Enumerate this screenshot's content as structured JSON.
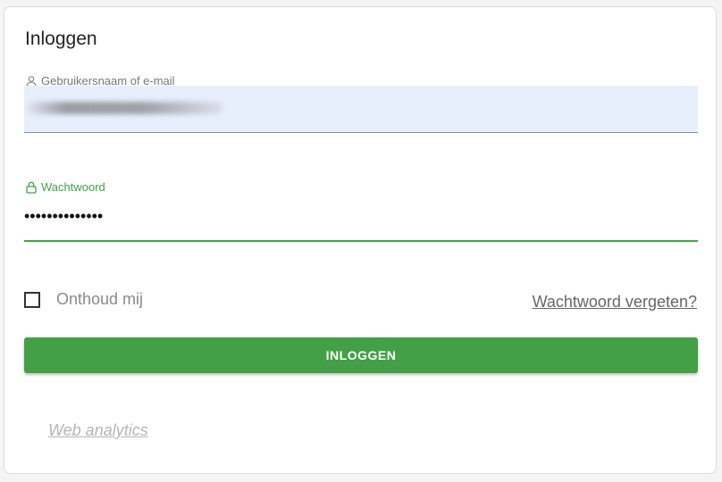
{
  "login": {
    "title": "Inloggen",
    "username": {
      "label": "Gebruikersnaam of e-mail",
      "icon": "user-icon"
    },
    "password": {
      "label": "Wachtwoord",
      "icon": "lock-icon",
      "value_masked": "••••••••••••••"
    },
    "remember_label": "Onthoud mij",
    "remember_checked": false,
    "forgot_link": "Wachtwoord vergeten?",
    "submit_label": "INLOGGEN",
    "analytics_link": "Web analytics"
  },
  "colors": {
    "accent": "#43a047",
    "username_fill": "#e8effc",
    "muted_text": "#8a8a8a"
  }
}
